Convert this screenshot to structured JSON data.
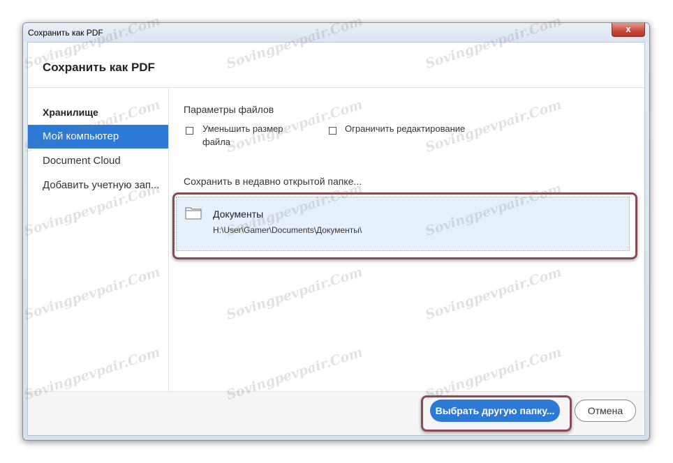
{
  "window": {
    "title": "Сохранить как PDF",
    "close_label": "x"
  },
  "header": {
    "title": "Сохранить как PDF"
  },
  "sidebar": {
    "heading": "Хранилище",
    "items": [
      {
        "label": "Мой компьютер",
        "active": true
      },
      {
        "label": "Document Cloud",
        "active": false
      },
      {
        "label": "Добавить учетную зап...",
        "active": false
      }
    ]
  },
  "file_options": {
    "title": "Параметры файлов",
    "reduce_size": {
      "label_line1": "Уменьшить размер",
      "label_line2": "файла",
      "checked": false
    },
    "restrict_editing": {
      "label": "Ограничить редактирование",
      "checked": false
    }
  },
  "recent": {
    "title": "Сохранить в недавно открытой папке...",
    "items": [
      {
        "name": "Документы",
        "path": "H:\\User\\Gamer\\Documents\\Документы\\"
      }
    ]
  },
  "footer": {
    "choose_folder_label": "Выбрать другую папку...",
    "cancel_label": "Отмена"
  },
  "watermark_text": "Sovingpevpair.Com",
  "colors": {
    "accent": "#2d7ad6",
    "highlight_frame": "#8a4a55",
    "selection_bg": "#e6f0fa"
  }
}
